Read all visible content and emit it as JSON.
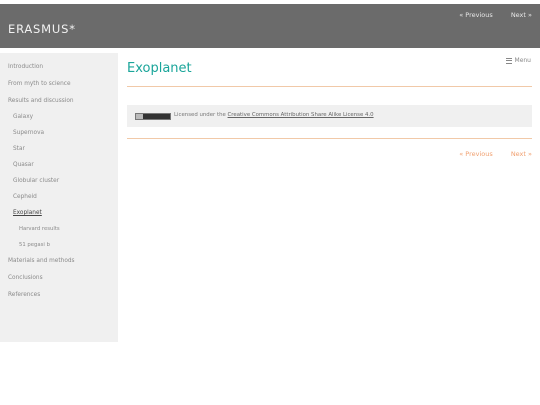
{
  "header": {
    "brand": "ERASMUS*",
    "nav_previous": "« Previous",
    "nav_next": "Next »"
  },
  "sidebar": {
    "items": [
      {
        "label": "Introduction",
        "level": 0
      },
      {
        "label": "From myth to science",
        "level": 0
      },
      {
        "label": "Results and discussion",
        "level": 0
      },
      {
        "label": "Galaxy",
        "level": 1
      },
      {
        "label": "Supernova",
        "level": 1
      },
      {
        "label": "Star",
        "level": 1
      },
      {
        "label": "Quasar",
        "level": 1
      },
      {
        "label": "Globular cluster",
        "level": 1
      },
      {
        "label": "Cepheid",
        "level": 1
      },
      {
        "label": "Exoplanet",
        "level": 1,
        "active": true
      },
      {
        "label": "Harvard results",
        "level": 2
      },
      {
        "label": "51 pegasi b",
        "level": 2
      },
      {
        "label": "Materials and methods",
        "level": 0
      },
      {
        "label": "Conclusions",
        "level": 0
      },
      {
        "label": "References",
        "level": 0
      }
    ]
  },
  "main": {
    "title": "Exoplanet",
    "menu_label": "Menu",
    "license_prefix": "Licensed under the ",
    "license_link": "Creative Commons Attribution Share Alike License 4.0",
    "nav_previous": "« Previous",
    "nav_next": "Next »"
  },
  "colors": {
    "topbar": "#6b6b6b",
    "accent_title": "#1aa59a",
    "accent_nav": "#f0a070",
    "rule": "#f1c9a8"
  }
}
